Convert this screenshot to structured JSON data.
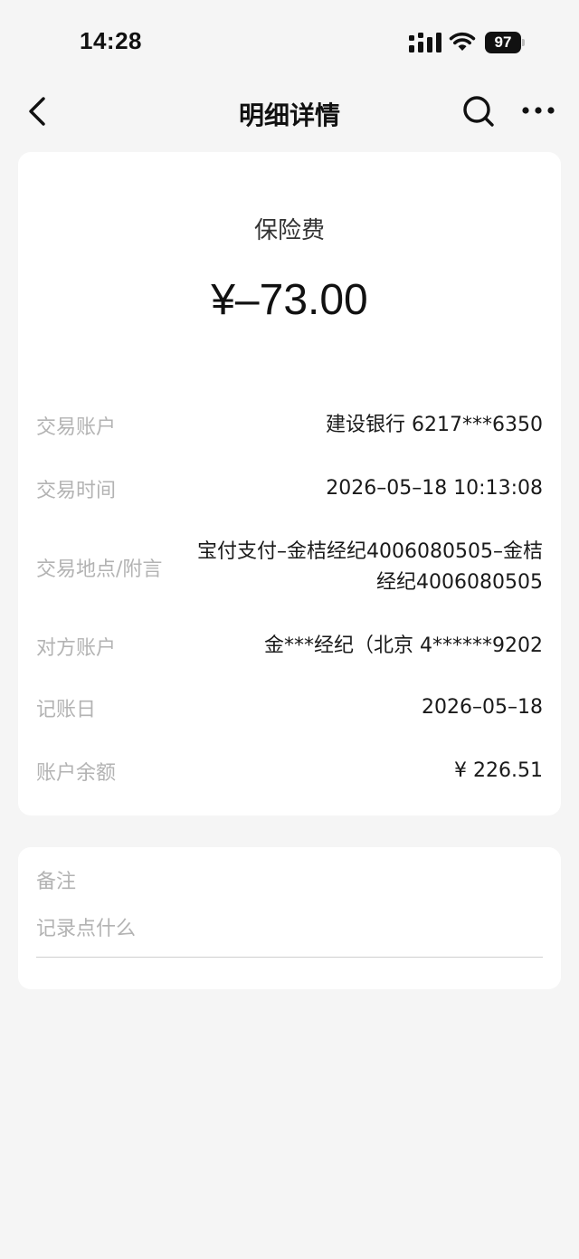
{
  "status_bar": {
    "time": "14:28",
    "battery": "97",
    "icons": [
      "signal-icon",
      "wifi-icon",
      "battery-icon"
    ]
  },
  "nav": {
    "title": "明细详情",
    "icons": [
      "back-icon",
      "search-icon",
      "more-icon"
    ]
  },
  "transaction": {
    "category": "保险费",
    "amount": "¥–73.00",
    "rows": [
      {
        "label": "交易账户",
        "value": "建设银行 6217***6350"
      },
      {
        "label": "交易时间",
        "value": "2026–05–18 10:13:08"
      },
      {
        "label": "交易地点/附言",
        "value": "宝付支付–金桔经纪4006080505–金桔经纪4006080505"
      },
      {
        "label": "对方账户",
        "value": "金***经纪（北京 4******9202"
      },
      {
        "label": "记账日",
        "value": "2026–05–18"
      },
      {
        "label": "账户余额",
        "value": "¥ 226.51"
      }
    ]
  },
  "memo": {
    "label": "备注",
    "placeholder": "记录点什么"
  }
}
